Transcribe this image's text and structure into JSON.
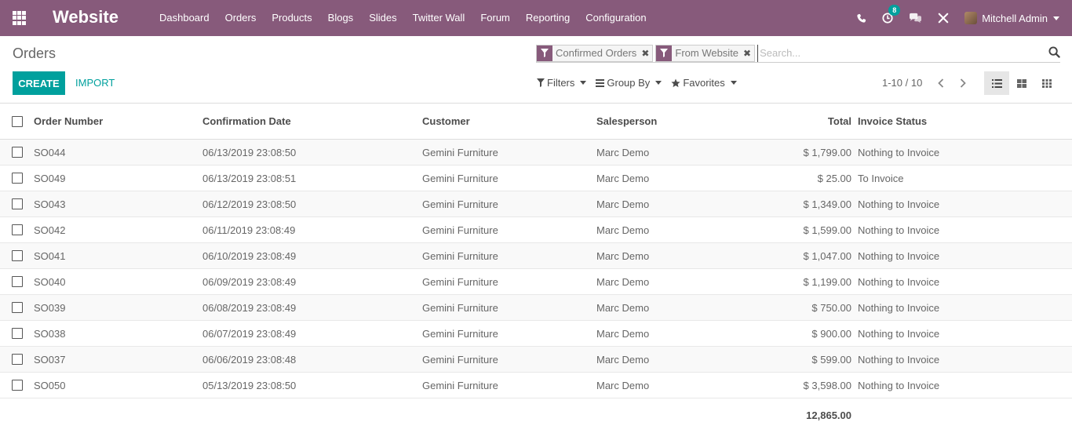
{
  "app": {
    "brand": "Website"
  },
  "menu": [
    "Dashboard",
    "Orders",
    "Products",
    "Blogs",
    "Slides",
    "Twitter Wall",
    "Forum",
    "Reporting",
    "Configuration"
  ],
  "systray": {
    "activity_count": "8",
    "user_name": "Mitchell Admin"
  },
  "breadcrumb": "Orders",
  "search": {
    "placeholder": "Search...",
    "facets": [
      "Confirmed Orders",
      "From Website"
    ]
  },
  "buttons": {
    "create": "CREATE",
    "import": "IMPORT"
  },
  "dropdowns": {
    "filters": "Filters",
    "group_by": "Group By",
    "favorites": "Favorites"
  },
  "pager": "1-10 / 10",
  "table": {
    "columns": [
      "Order Number",
      "Confirmation Date",
      "Customer",
      "Salesperson",
      "Total",
      "Invoice Status"
    ],
    "rows": [
      [
        "SO044",
        "06/13/2019 23:08:50",
        "Gemini Furniture",
        "Marc Demo",
        "$ 1,799.00",
        "Nothing to Invoice"
      ],
      [
        "SO049",
        "06/13/2019 23:08:51",
        "Gemini Furniture",
        "Marc Demo",
        "$ 25.00",
        "To Invoice"
      ],
      [
        "SO043",
        "06/12/2019 23:08:50",
        "Gemini Furniture",
        "Marc Demo",
        "$ 1,349.00",
        "Nothing to Invoice"
      ],
      [
        "SO042",
        "06/11/2019 23:08:49",
        "Gemini Furniture",
        "Marc Demo",
        "$ 1,599.00",
        "Nothing to Invoice"
      ],
      [
        "SO041",
        "06/10/2019 23:08:49",
        "Gemini Furniture",
        "Marc Demo",
        "$ 1,047.00",
        "Nothing to Invoice"
      ],
      [
        "SO040",
        "06/09/2019 23:08:49",
        "Gemini Furniture",
        "Marc Demo",
        "$ 1,199.00",
        "Nothing to Invoice"
      ],
      [
        "SO039",
        "06/08/2019 23:08:49",
        "Gemini Furniture",
        "Marc Demo",
        "$ 750.00",
        "Nothing to Invoice"
      ],
      [
        "SO038",
        "06/07/2019 23:08:49",
        "Gemini Furniture",
        "Marc Demo",
        "$ 900.00",
        "Nothing to Invoice"
      ],
      [
        "SO037",
        "06/06/2019 23:08:48",
        "Gemini Furniture",
        "Marc Demo",
        "$ 599.00",
        "Nothing to Invoice"
      ],
      [
        "SO050",
        "05/13/2019 23:08:50",
        "Gemini Furniture",
        "Marc Demo",
        "$ 3,598.00",
        "Nothing to Invoice"
      ]
    ],
    "grand_total": "12,865.00"
  },
  "colors": {
    "navbar": "#875a7b",
    "primary": "#00a09d"
  }
}
